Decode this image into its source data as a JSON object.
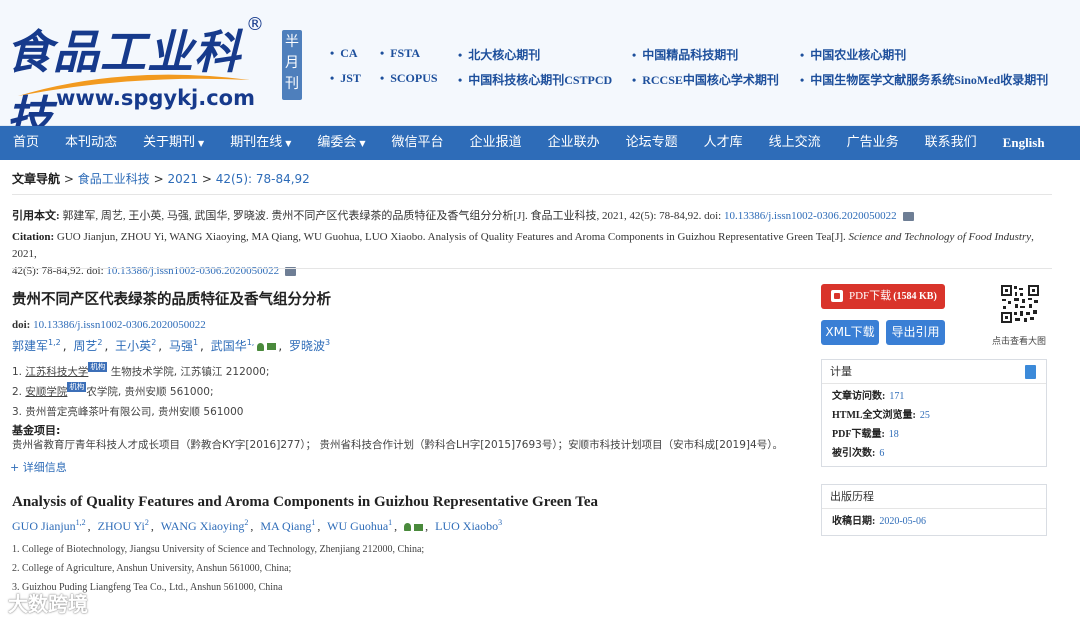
{
  "header": {
    "logo_text": "食品工业科技",
    "logo_reg": "®",
    "logo_url": "www.spgykj.com",
    "banyue": [
      "半",
      "月",
      "刊"
    ],
    "indexes_row1": [
      "CA",
      "FSTA",
      "北大核心期刊",
      "中国精品科技期刊",
      "中国农业核心期刊"
    ],
    "indexes_row2": [
      "JST",
      "SCOPUS",
      "中国科技核心期刊CSTPCD",
      "RCCSE中国核心学术期刊",
      "中国生物医学文献服务系统SinoMed收录期刊"
    ]
  },
  "nav": {
    "items": [
      {
        "label": "首页",
        "caret": false
      },
      {
        "label": "本刊动态",
        "caret": false
      },
      {
        "label": "关于期刊",
        "caret": true
      },
      {
        "label": "期刊在线",
        "caret": true
      },
      {
        "label": "编委会",
        "caret": true
      },
      {
        "label": "微信平台",
        "caret": false
      },
      {
        "label": "企业报道",
        "caret": false
      },
      {
        "label": "企业联办",
        "caret": false
      },
      {
        "label": "论坛专题",
        "caret": false
      },
      {
        "label": "人才库",
        "caret": false
      },
      {
        "label": "线上交流",
        "caret": false
      },
      {
        "label": "广告业务",
        "caret": false
      },
      {
        "label": "联系我们",
        "caret": false
      },
      {
        "label": "English",
        "caret": false
      }
    ]
  },
  "breadcrumb": {
    "label": "文章导航",
    "sep": ">",
    "journal": "食品工业科技",
    "year": "2021",
    "issue": "42(5): 78-84,92"
  },
  "citation_cn": {
    "label": "引用本文:",
    "text": "郭建军, 周艺, 王小英, 马强, 武国华, 罗晓波. 贵州不同产区代表绿茶的品质特征及香气组分分析[J]. 食品工业科技, 2021, 42(5): 78-84,92. doi: ",
    "doi": "10.13386/j.issn1002-0306.2020050022"
  },
  "citation_en": {
    "label": "Citation:",
    "text": "GUO Jianjun, ZHOU Yi, WANG Xiaoying, MA Qiang, WU Guohua, LUO Xiaobo. Analysis of Quality Features and Aroma Components in Guizhou Representative Green Tea[J]. ",
    "journal": "Science and Technology of Food Industry",
    "text2": ", 2021,",
    "text3": "42(5): 78-84,92. doi: ",
    "doi": "10.13386/j.issn1002-0306.2020050022"
  },
  "article": {
    "title_cn": "贵州不同产区代表绿茶的品质特征及香气组分分析",
    "doi_label": "doi:",
    "doi": "10.13386/j.issn1002-0306.2020050022",
    "authors_cn": [
      {
        "name": "郭建军",
        "sup": "1,2"
      },
      {
        "name": "周艺",
        "sup": "2"
      },
      {
        "name": "王小英",
        "sup": "2"
      },
      {
        "name": "马强",
        "sup": "1"
      },
      {
        "name": "武国华",
        "sup": "1,"
      },
      {
        "name": "罗晓波",
        "sup": "3"
      }
    ],
    "aff_cn": [
      {
        "num": "1.",
        "inst": "江苏科技大学",
        "badge": "机构",
        "rest": "生物技术学院, 江苏镇江 212000;"
      },
      {
        "num": "2.",
        "inst": "安顺学院",
        "badge": "机构",
        "rest": "农学院, 贵州安顺 561000;"
      },
      {
        "num": "3.",
        "inst": "",
        "badge": "",
        "rest": "贵州普定亮峰茶叶有限公司, 贵州安顺 561000"
      }
    ],
    "fund_label": "基金项目:",
    "fund_text": "贵州省教育厅青年科技人才成长项目（黔教合KY字[2016]277）； 贵州省科技合作计划（黔科合LH字[2015]7693号）；安顺市科技计划项目（安市科成[2019]4号）。",
    "more_label": "+ 详细信息",
    "title_en": "Analysis of Quality Features and Aroma Components in Guizhou Representative Green Tea",
    "authors_en": [
      {
        "name": "GUO Jianjun",
        "sup": "1,2"
      },
      {
        "name": "ZHOU Yi",
        "sup": "2"
      },
      {
        "name": "WANG Xiaoying",
        "sup": "2"
      },
      {
        "name": "MA Qiang",
        "sup": "1"
      },
      {
        "name": "WU Guohua",
        "sup": "1"
      },
      {
        "name": "LUO Xiaobo",
        "sup": "3"
      }
    ],
    "aff_en": [
      "1. College of Biotechnology, Jiangsu University of Science and Technology, Zhenjiang 212000, China;",
      "2. College of Agriculture, Anshun University, Anshun 561000, China;",
      "3. Guizhou Puding Liangfeng Tea Co., Ltd., Anshun 561000, China"
    ]
  },
  "sidebar": {
    "pdf_label": "PDF下载",
    "pdf_size": "(1584 KB)",
    "xml_label": "XML下载",
    "export_label": "导出引用",
    "qr_label": "点击查看大图",
    "metrics_title": "计量",
    "metrics": [
      {
        "label": "文章访问数:",
        "value": "171"
      },
      {
        "label": "HTML全文浏览量:",
        "value": "25"
      },
      {
        "label": "PDF下载量:",
        "value": "18"
      },
      {
        "label": "被引次数:",
        "value": "6"
      }
    ],
    "history_title": "出版历程",
    "history": [
      {
        "label": "收稿日期:",
        "value": "2020-05-06"
      }
    ]
  },
  "watermark": "大数跨境",
  "colors": {
    "nav_bg": "#2e6cb8",
    "pdf_red": "#d9342b",
    "link": "#2e6cb8"
  }
}
